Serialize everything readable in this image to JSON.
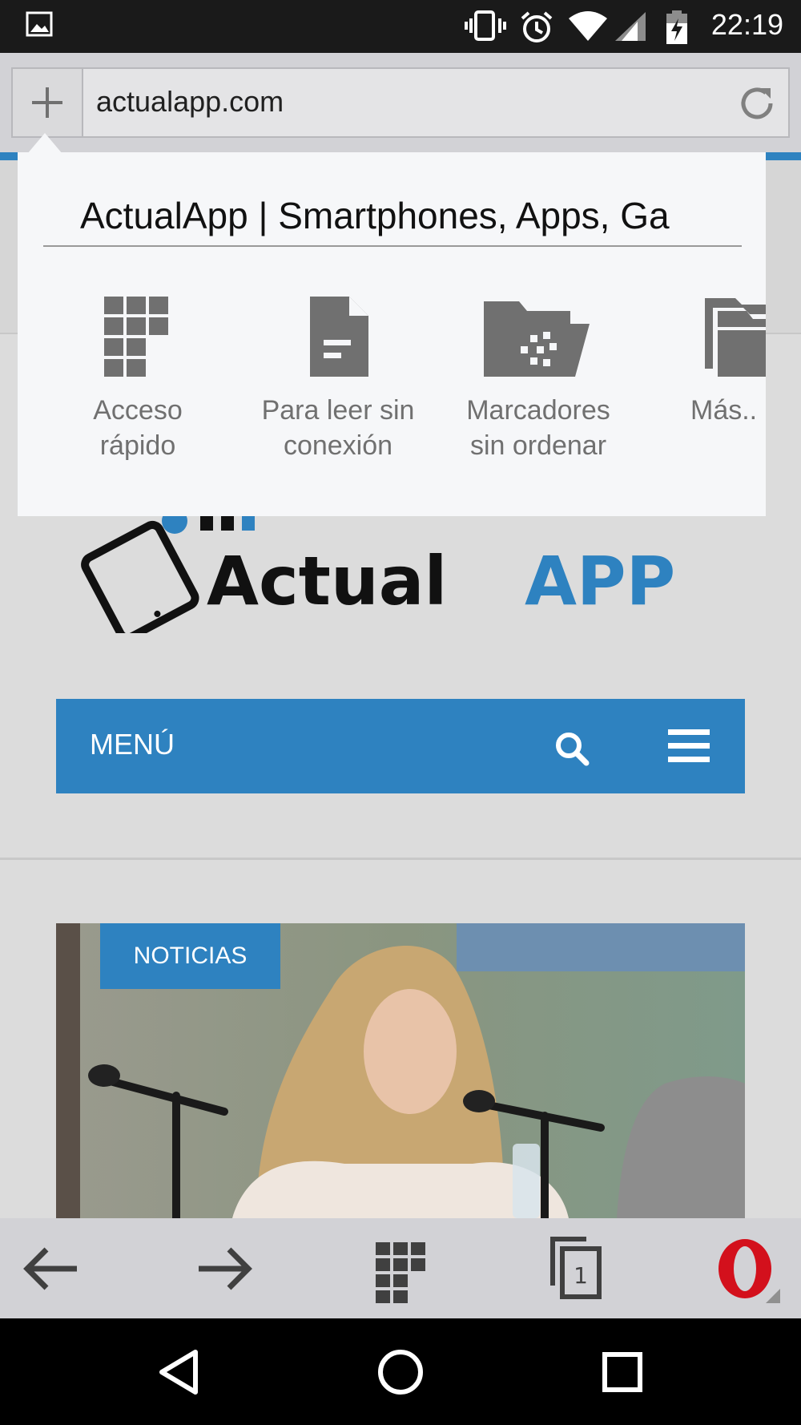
{
  "status_bar": {
    "time": "22:19",
    "icons": [
      "image-notification-icon",
      "vibrate-icon",
      "alarm-icon",
      "wifi-icon",
      "signal-icon",
      "battery-charging-icon"
    ]
  },
  "address_bar": {
    "url": "actualapp.com",
    "add_icon": "plus-icon",
    "reload_icon": "reload-icon"
  },
  "popup": {
    "title_value": "ActualApp | Smartphones, Apps, Ga",
    "destinations": [
      {
        "line1": "Acceso",
        "line2": "rápido",
        "icon": "speed-dial-grid-icon"
      },
      {
        "line1": "Para leer sin",
        "line2": "conexión",
        "icon": "offline-page-icon"
      },
      {
        "line1": "Marcadores",
        "line2": "sin ordenar",
        "icon": "unsorted-bookmarks-folder-icon"
      },
      {
        "line1": "Más..",
        "line2": "",
        "icon": "more-folders-icon"
      }
    ]
  },
  "site": {
    "logo_text_1": "Actual",
    "logo_text_2": "APP",
    "menu_label": "MENÚ",
    "badge": "NOTICIAS"
  },
  "toolbar": {
    "tab_count": "1",
    "icons": [
      "back-arrow-icon",
      "forward-arrow-icon",
      "speed-dial-icon",
      "tabs-icon",
      "opera-menu-icon"
    ]
  },
  "colors": {
    "accent": "#2e82c0",
    "opera_red": "#d3101c",
    "status_bar": "#1a1a1a"
  }
}
